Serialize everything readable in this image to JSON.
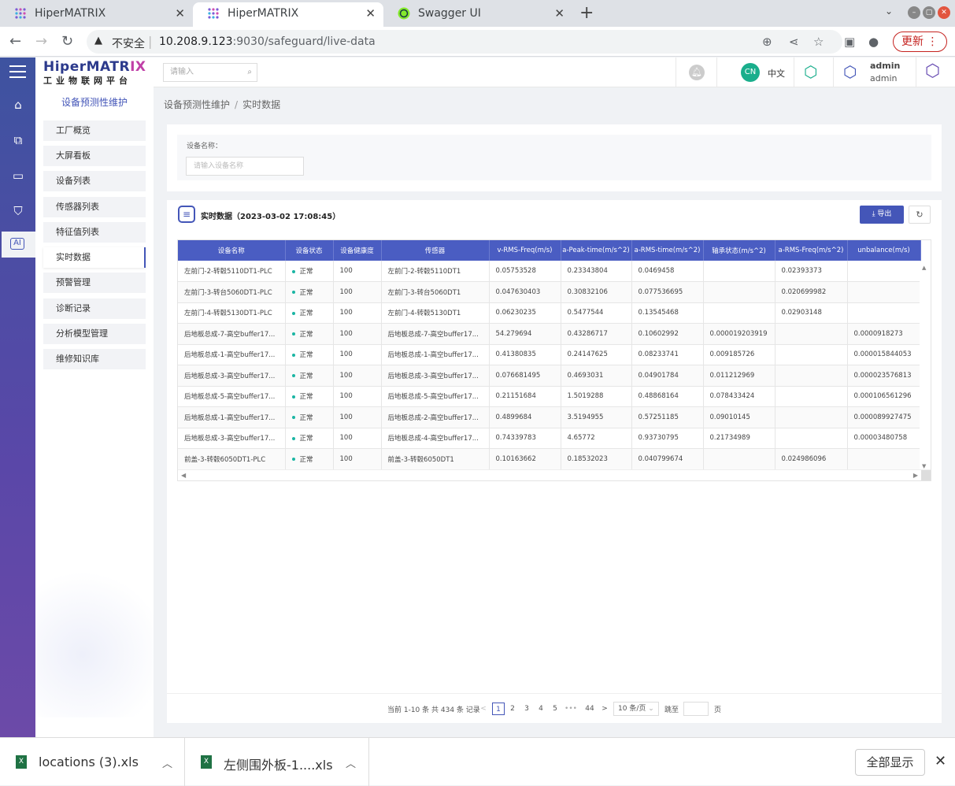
{
  "browser": {
    "tabs": [
      {
        "title": "HiperMATRIX",
        "active": false
      },
      {
        "title": "HiperMATRIX",
        "active": true
      },
      {
        "title": "Swagger UI",
        "active": false
      }
    ],
    "security_label": "不安全",
    "url_host": "10.208.9.123",
    "url_rest": ":9030/safeguard/live-data",
    "update_label": "更新"
  },
  "app": {
    "logo_main": "HiperMATR",
    "logo_accent": "IX",
    "logo_sub": "工业物联网平台",
    "search_placeholder": "请输入",
    "lang_badge": "CN",
    "lang_label": "中文",
    "user_name": "admin",
    "user_role": "admin"
  },
  "sidebar": {
    "title": "设备预测性维护",
    "items": [
      {
        "label": "工厂概览",
        "active": false
      },
      {
        "label": "大屏看板",
        "active": false
      },
      {
        "label": "设备列表",
        "active": false
      },
      {
        "label": "传感器列表",
        "active": false
      },
      {
        "label": "特征值列表",
        "active": false
      },
      {
        "label": "实时数据",
        "active": true
      },
      {
        "label": "预警管理",
        "active": false
      },
      {
        "label": "诊断记录",
        "active": false
      },
      {
        "label": "分析模型管理",
        "active": false
      },
      {
        "label": "维修知识库",
        "active": false
      }
    ]
  },
  "breadcrumb": {
    "parent": "设备预测性维护",
    "sep": "/",
    "current": "实时数据"
  },
  "filter": {
    "label": "设备名称：",
    "placeholder": "请输入设备名称"
  },
  "panel": {
    "title": "实时数据（2023-03-02 17:08:45）",
    "export_label": "导出",
    "refresh_label": "↻"
  },
  "table": {
    "headers": [
      "设备名称",
      "设备状态",
      "设备健康度",
      "传感器",
      "v-RMS-Freq(m/s)",
      "a-Peak-time(m/s^2)",
      "a-RMS-time(m/s^2)",
      "轴承状态(m/s^2)",
      "a-RMS-Freq(m/s^2)",
      "unbalance(m/s)"
    ],
    "rows": [
      [
        "左前门-2-转毂5110DT1-PLC",
        "正常",
        "100",
        "左前门-2-转毂5110DT1",
        "0.05753528",
        "0.23343804",
        "0.0469458",
        "",
        "0.02393373",
        ""
      ],
      [
        "左前门-3-转台5060DT1-PLC",
        "正常",
        "100",
        "左前门-3-转台5060DT1",
        "0.047630403",
        "0.30832106",
        "0.077536695",
        "",
        "0.020699982",
        ""
      ],
      [
        "左前门-4-转毂5130DT1-PLC",
        "正常",
        "100",
        "左前门-4-转毂5130DT1",
        "0.06230235",
        "0.5477544",
        "0.13545468",
        "",
        "0.02903148",
        ""
      ],
      [
        "后地板总成-7-高空buffer17...",
        "正常",
        "100",
        "后地板总成-7-高空buffer17...",
        "54.279694",
        "0.43286717",
        "0.10602992",
        "0.000019203919",
        "",
        "0.0000918273"
      ],
      [
        "后地板总成-1-高空buffer17...",
        "正常",
        "100",
        "后地板总成-1-高空buffer17...",
        "0.41380835",
        "0.24147625",
        "0.08233741",
        "0.009185726",
        "",
        "0.000015844053"
      ],
      [
        "后地板总成-3-高空buffer17...",
        "正常",
        "100",
        "后地板总成-3-高空buffer17...",
        "0.076681495",
        "0.4693031",
        "0.04901784",
        "0.011212969",
        "",
        "0.000023576813"
      ],
      [
        "后地板总成-5-高空buffer17...",
        "正常",
        "100",
        "后地板总成-5-高空buffer17...",
        "0.21151684",
        "1.5019288",
        "0.48868164",
        "0.078433424",
        "",
        "0.000106561296"
      ],
      [
        "后地板总成-1-高空buffer17...",
        "正常",
        "100",
        "后地板总成-2-高空buffer17...",
        "0.4899684",
        "3.5194955",
        "0.57251185",
        "0.09010145",
        "",
        "0.000089927475"
      ],
      [
        "后地板总成-3-高空buffer17...",
        "正常",
        "100",
        "后地板总成-4-高空buffer17...",
        "0.74339783",
        "4.65772",
        "0.93730795",
        "0.21734989",
        "",
        "0.00003480758"
      ],
      [
        "前盖-3-转毂6050DT1-PLC",
        "正常",
        "100",
        "前盖-3-转毂6050DT1",
        "0.10163662",
        "0.18532023",
        "0.040799674",
        "",
        "0.024986096",
        ""
      ]
    ]
  },
  "pagination": {
    "info": "当前 1-10 条 共 434 条 记录",
    "prev": "<",
    "pages": [
      "1",
      "2",
      "3",
      "4",
      "5",
      "•••",
      "44"
    ],
    "current": "1",
    "next": ">",
    "page_size": "10 条/页",
    "goto_label": "跳至",
    "page_suffix": "页"
  },
  "downloads": {
    "files": [
      "locations (3).xls",
      "左侧围外板-1....xls"
    ],
    "show_all": "全部显示"
  }
}
